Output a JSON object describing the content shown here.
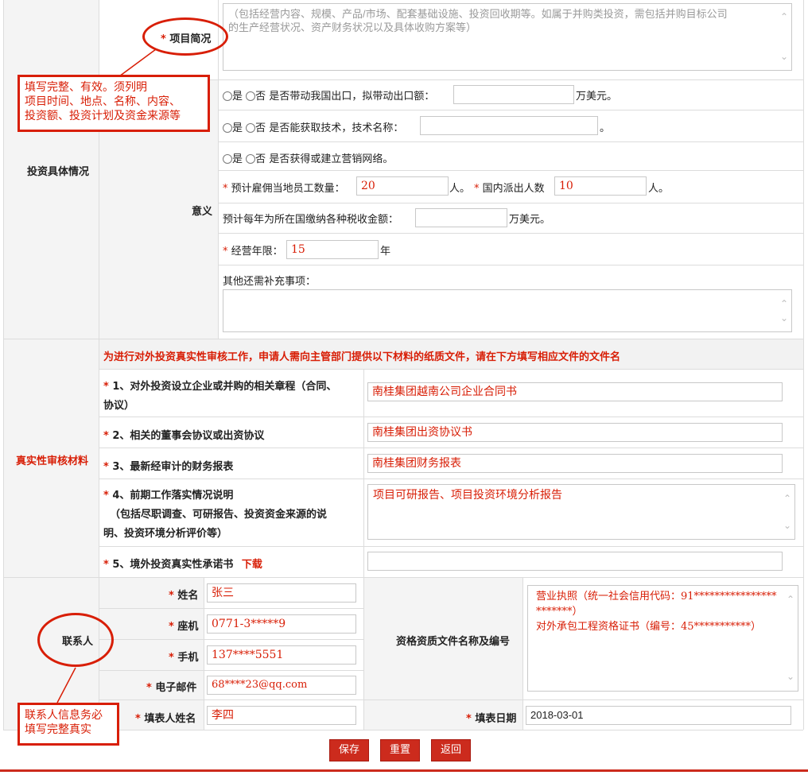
{
  "project_overview": {
    "label": "项目简况",
    "placeholder_line1": "（包括经营内容、规模、产品/市场、配套基础设施、投资回收期等。如属于并购类投资，需包括并购目标公司",
    "placeholder_line2": "的生产经营状况、资产财务状况以及具体收购方案等）"
  },
  "investment_details": {
    "section_label": "投资具体情况",
    "significance_label": "意义",
    "radio_yes": "是",
    "radio_no": "否",
    "export_question": "是否带动我国出口，拟带动出口额：",
    "export_unit": "万美元。",
    "tech_question": "是否能获取技术，技术名称：",
    "tech_suffix": "。",
    "marketing_question": "是否获得或建立营销网络。",
    "local_employees_label": "预计雇佣当地员工数量：",
    "local_employees_value": "20",
    "person_unit": "人。",
    "dispatched_label": "国内派出人数",
    "dispatched_value": "10",
    "tax_label": "预计每年为所在国缴纳各种税收金额：",
    "tax_unit": "万美元。",
    "term_label": "经营年限：",
    "term_value": "15",
    "term_unit": "年",
    "other_label": "其他还需补充事项："
  },
  "authenticity": {
    "section_label": "真实性审核材料",
    "notice": "为进行对外投资真实性审核工作，申请人需向主管部门提供以下材料的纸质文件，请在下方填写相应文件的文件名",
    "item1_line1": "1、对外投资设立企业或并购的相关章程（合同、",
    "item1_line2": "协议）",
    "item1_value": "南桂集团越南公司企业合同书",
    "item2": "2、相关的董事会协议或出资协议",
    "item2_value": "南桂集团出资协议书",
    "item3": "3、最新经审计的财务报表",
    "item3_value": "南桂集团财务报表",
    "item4_line1": "4、前期工作落实情况说明",
    "item4_line2": "（包括尽职调查、可研报告、投资资金来源的说",
    "item4_line3": "明、投资环境分析评价等）",
    "item4_value": "项目可研报告、项目投资环境分析报告",
    "item5": "5、境外投资真实性承诺书",
    "item5_link": "下载",
    "item5_value": ""
  },
  "contact": {
    "section_label": "联系人",
    "name_label": "姓名",
    "name_value": "张三",
    "landline_label": "座机",
    "landline_value": "0771-3*****9",
    "mobile_label": "手机",
    "mobile_value": "137****5551",
    "email_label": "电子邮件",
    "email_value": "68****23@qq.com",
    "filler_label": "填表人姓名",
    "filler_value": "李四",
    "qualification_label": "资格资质文件名称及编号",
    "qualification_value": "营业执照（统一社会信用代码：91***********************）\n对外承包工程资格证书（编号：45***********）",
    "date_label": "填表日期",
    "date_value": "2018-03-01"
  },
  "buttons": {
    "save": "保存",
    "reset": "重置",
    "back": "返回"
  },
  "annotations": {
    "box1_line1": "填写完整、有效。须列明",
    "box1_line2": "项目时间、地点、名称、内容、",
    "box1_line3": "投资额、投资计划及资金来源等",
    "box2_line1": "联系人信息务必",
    "box2_line2": "填写完整真实"
  },
  "required_mark": "*",
  "colors": {
    "accent_red": "#d81e06",
    "button_red": "#cc2b1d",
    "label_bg": "#f4f4f4",
    "notice_bg": "#f2f2f2"
  }
}
